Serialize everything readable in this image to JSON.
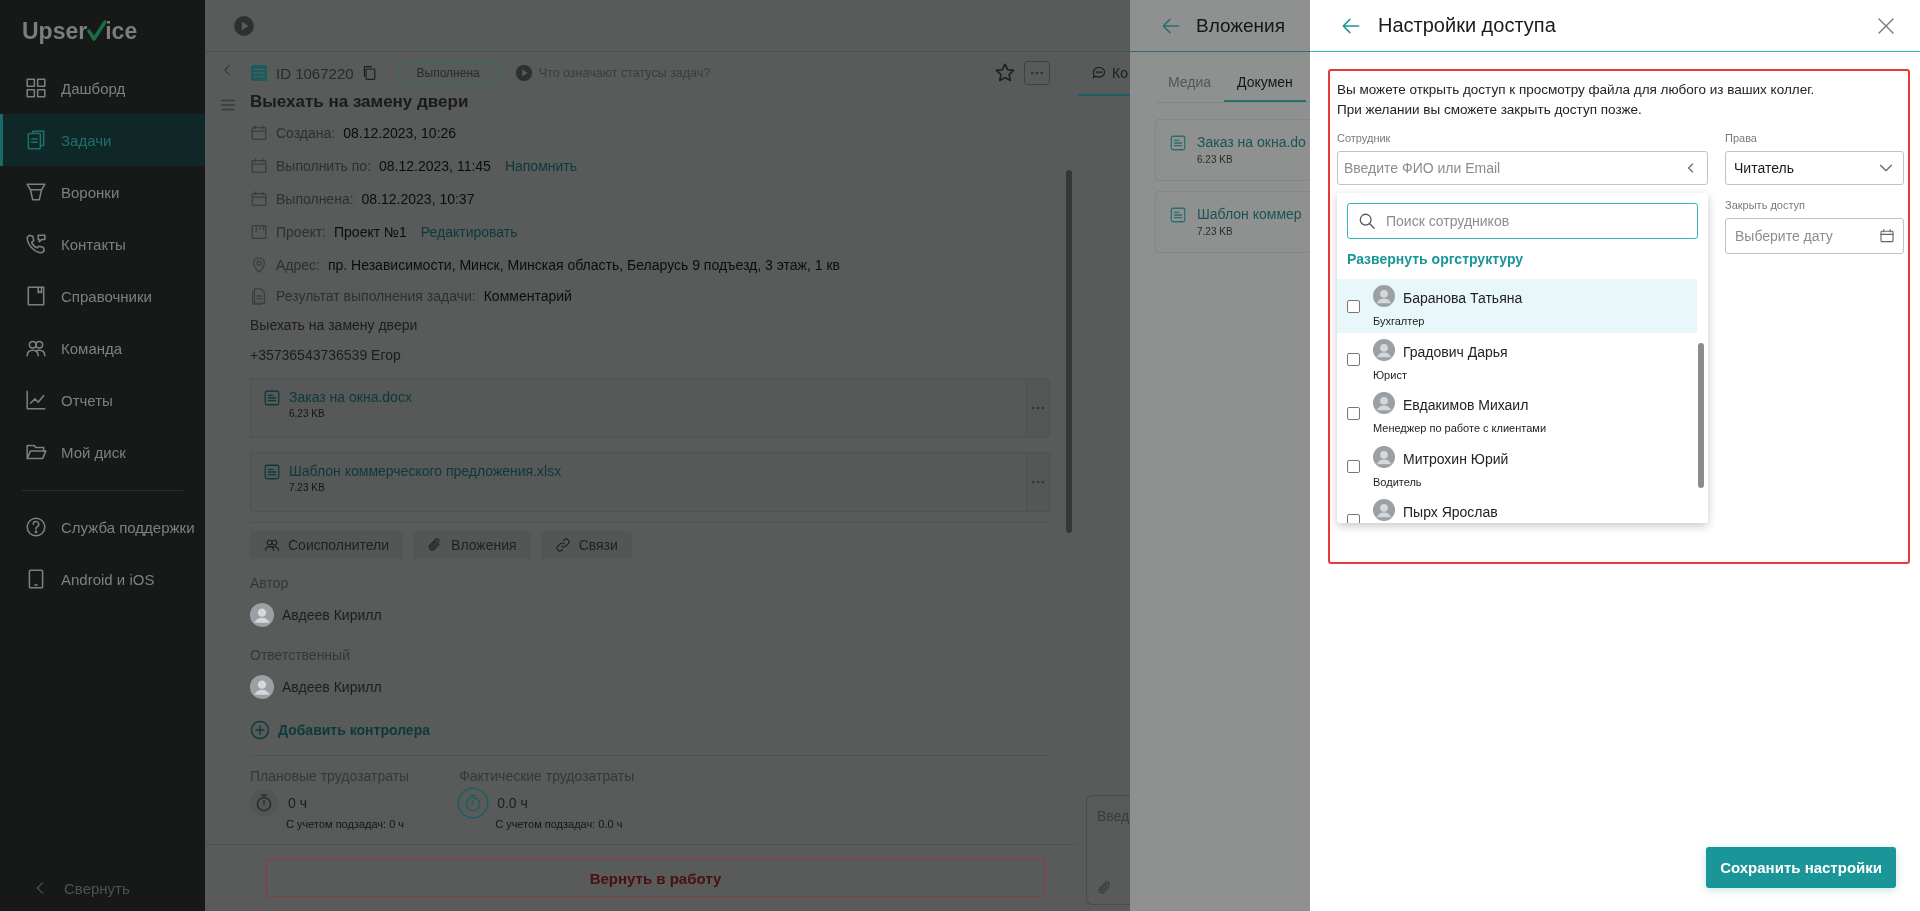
{
  "sidebar": {
    "logo": {
      "before_mark": "Upser",
      "after_mark": "ice"
    },
    "items": [
      {
        "label": "Дашборд",
        "kind": "dashboard",
        "selected": false
      },
      {
        "label": "Задачи",
        "kind": "tasks",
        "selected": true
      },
      {
        "label": "Воронки",
        "kind": "funnels",
        "selected": false
      },
      {
        "label": "Контакты",
        "kind": "contacts",
        "selected": false
      },
      {
        "label": "Справочники",
        "kind": "directory",
        "selected": false
      },
      {
        "label": "Команда",
        "kind": "team",
        "selected": false
      },
      {
        "label": "Отчеты",
        "kind": "reports",
        "selected": false
      },
      {
        "label": "Мой диск",
        "kind": "disk",
        "selected": false
      }
    ],
    "help_items": [
      {
        "label": "Служба поддержки",
        "kind": "support",
        "selected": false
      },
      {
        "label": "Android и iOS",
        "kind": "mobile",
        "selected": false
      }
    ],
    "collapse": "Свернуть"
  },
  "task": {
    "id": "ID 1067220",
    "status": "Выполнена",
    "status_help": "Что означают статусы задач?",
    "starred": false,
    "title": "Выехать на замену двери",
    "fields": [
      {
        "kind": "date",
        "label": "Создана:",
        "value": "08.12.2023, 10:26"
      },
      {
        "kind": "date",
        "label": "Выполнить по:",
        "value": "08.12.2023, 11:45",
        "link": "Напомнить"
      },
      {
        "kind": "date",
        "label": "Выполнена:",
        "value": "08.12.2023, 10:37"
      },
      {
        "kind": "project",
        "label": "Проект:",
        "value": "Проект №1",
        "link": "Редактировать"
      },
      {
        "kind": "address",
        "label": "Адрес:",
        "value": "пр. Независимости, Минск, Минская область, Беларусь 9 подъезд, 3 этаж, 1 кв"
      },
      {
        "kind": "result",
        "label": "Результат выполнения задачи:",
        "value": "Комментарий"
      }
    ],
    "description": [
      "Выехать на замену двери",
      "+35736543736539 Егор"
    ],
    "files": [
      {
        "name": "Заказ на окна.docx",
        "size": "6.23 KB"
      },
      {
        "name": "Шаблон коммерческого предложения.xlsx",
        "size": "7.23 KB"
      }
    ],
    "sections": [
      {
        "kind": "people",
        "label": "Соисполнители"
      },
      {
        "kind": "attachments",
        "label": "Вложения"
      },
      {
        "kind": "links",
        "label": "Связи"
      }
    ],
    "people": [
      {
        "role": "Автор",
        "name": "Авдеев Кирилл"
      },
      {
        "role": "Ответственный",
        "name": "Авдеев Кирилл"
      }
    ],
    "add_controller": "Добавить контролера",
    "efforts": [
      {
        "label": "Плановые трудозатраты",
        "value": "0 ч",
        "note": "С учетом подзадач: 0 ч",
        "active": false
      },
      {
        "label": "Фактические трудозатраты",
        "value": "0.0 ч",
        "note": "С учетом подзадач: 0.0 ч",
        "active": true
      }
    ],
    "return_button": "Вернуть в работу"
  },
  "comments": {
    "tab": "Ко",
    "placeholder": "Введ"
  },
  "attachments_panel": {
    "title": "Вложения",
    "tabs": [
      {
        "label": "Медиа",
        "selected": false
      },
      {
        "label": "Докумен",
        "selected": true
      }
    ],
    "files": [
      {
        "name": "Заказ на окна.do",
        "size": "6.23 KB"
      },
      {
        "name": "Шаблон коммер",
        "size": "7.23 KB"
      }
    ]
  },
  "access_settings": {
    "title": "Настройки доступа",
    "intro": [
      "Вы можете открыть доступ к просмотру файла для любого из ваших коллег.",
      "При желании вы сможете закрыть доступ позже."
    ],
    "employee_field": {
      "label": "Сотрудник",
      "placeholder": "Введите ФИО или Email"
    },
    "rights_field": {
      "label": "Права",
      "value": "Читатель"
    },
    "close_field": {
      "label": "Закрыть доступ",
      "placeholder": "Выберите дату"
    },
    "dropdown": {
      "search_placeholder": "Поиск сотрудников",
      "expand_link": "Развернуть оргструктуру",
      "employees": [
        {
          "name": "Баранова Татьяна",
          "role": "Бухгалтер",
          "checked": false,
          "highlighted": true
        },
        {
          "name": "Градович Дарья",
          "role": "Юрист",
          "checked": false,
          "highlighted": false
        },
        {
          "name": "Евдакимов Михаил",
          "role": "Менеджер по работе с клиентами",
          "checked": false,
          "highlighted": false
        },
        {
          "name": "Митрохин Юрий",
          "role": "Водитель",
          "checked": false,
          "highlighted": false
        },
        {
          "name": "Пырх Ярослав",
          "checked": false,
          "highlighted": false
        }
      ]
    },
    "save_button": "Сохранить настройки"
  }
}
